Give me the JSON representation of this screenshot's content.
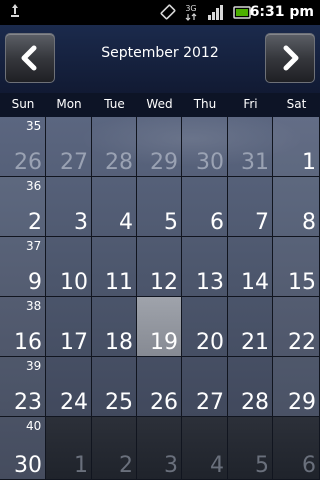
{
  "status_bar": {
    "time": "6:31 pm",
    "icons": [
      "usb-debug-icon",
      "vibrate-icon",
      "3g-data-icon",
      "signal-bars-icon",
      "battery-icon"
    ],
    "colors": {
      "background": "#000000",
      "battery": "#4caf00"
    }
  },
  "header": {
    "title": "September 2012",
    "prev_icon": "chevron-left-icon",
    "next_icon": "chevron-right-icon"
  },
  "weekdays": [
    "Sun",
    "Mon",
    "Tue",
    "Wed",
    "Thu",
    "Fri",
    "Sat"
  ],
  "weeks": [
    {
      "week": "35",
      "days": [
        "26",
        "27",
        "28",
        "29",
        "30",
        "31",
        "1"
      ],
      "state": [
        "prev",
        "prev",
        "prev",
        "prev",
        "prev",
        "prev",
        "cur"
      ]
    },
    {
      "week": "36",
      "days": [
        "2",
        "3",
        "4",
        "5",
        "6",
        "7",
        "8"
      ],
      "state": [
        "cur",
        "cur",
        "cur",
        "cur",
        "cur",
        "cur",
        "cur"
      ]
    },
    {
      "week": "37",
      "days": [
        "9",
        "10",
        "11",
        "12",
        "13",
        "14",
        "15"
      ],
      "state": [
        "cur",
        "cur",
        "cur",
        "cur",
        "cur",
        "cur",
        "cur"
      ]
    },
    {
      "week": "38",
      "days": [
        "16",
        "17",
        "18",
        "19",
        "20",
        "21",
        "22"
      ],
      "state": [
        "cur",
        "cur",
        "cur",
        "selected",
        "cur",
        "cur",
        "cur"
      ]
    },
    {
      "week": "39",
      "days": [
        "23",
        "24",
        "25",
        "26",
        "27",
        "28",
        "29"
      ],
      "state": [
        "cur",
        "cur",
        "cur",
        "cur",
        "cur",
        "cur",
        "cur"
      ]
    },
    {
      "week": "40",
      "days": [
        "30",
        "1",
        "2",
        "3",
        "4",
        "5",
        "6"
      ],
      "state": [
        "cur",
        "next",
        "next",
        "next",
        "next",
        "next",
        "next"
      ]
    }
  ],
  "selected_day": "19"
}
